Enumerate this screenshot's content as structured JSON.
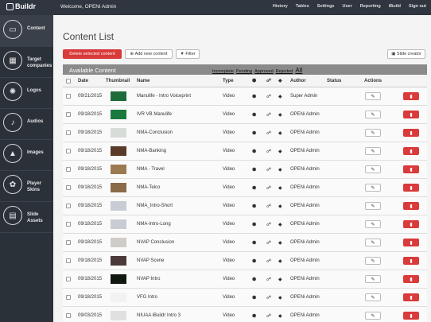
{
  "header": {
    "logo": "Buildr",
    "welcome": "Welcome, OPENi Admin",
    "nav": [
      "History",
      "Tables",
      "Settings",
      "User",
      "Reporting",
      "iBuild",
      "Sign out"
    ]
  },
  "sidebar": {
    "items": [
      {
        "label": "Content",
        "icon": "content-icon",
        "glyph": "▭"
      },
      {
        "label": "Target companies",
        "icon": "companies-icon",
        "glyph": "▦"
      },
      {
        "label": "Logos",
        "icon": "flame-icon",
        "glyph": "✺"
      },
      {
        "label": "Audios",
        "icon": "music-icon",
        "glyph": "♪"
      },
      {
        "label": "Images",
        "icon": "image-icon",
        "glyph": "▲"
      },
      {
        "label": "Player Skins",
        "icon": "palette-icon",
        "glyph": "✿"
      },
      {
        "label": "Slide Assets",
        "icon": "slides-icon",
        "glyph": "▤"
      }
    ]
  },
  "page": {
    "title": "Content List",
    "delete_label": "Delete selected content",
    "add_label": "Add new content",
    "filter_label": "Filter",
    "slide_creator_label": "Slide creator",
    "available": "Available Content",
    "filters": [
      "Incomplete",
      "Pending",
      "Approved",
      "Rejected",
      "All"
    ]
  },
  "table": {
    "headers": {
      "date": "Date",
      "thumb": "Thumbnail",
      "name": "Name",
      "type": "Type",
      "author": "Author",
      "status": "Status",
      "actions": "Actions"
    },
    "rows": [
      {
        "date": "09/21/2015",
        "name": "Manulife - Intro Voiceprint",
        "type": "Video",
        "author": "Super Admin",
        "thumb": "#1e6b3a"
      },
      {
        "date": "09/18/2015",
        "name": "IVR VB Manulife",
        "type": "Video",
        "author": "OPENi Admin",
        "thumb": "#1a7a3e"
      },
      {
        "date": "09/18/2015",
        "name": "NMA-Conclusion",
        "type": "Video",
        "author": "OPENi Admin",
        "thumb": "#d8dcd8"
      },
      {
        "date": "09/18/2015",
        "name": "NMA-Banking",
        "type": "Video",
        "author": "OPENi Admin",
        "thumb": "#5a3a28"
      },
      {
        "date": "09/18/2015",
        "name": "NMA - Travel",
        "type": "Video",
        "author": "OPENi Admin",
        "thumb": "#9a7a50"
      },
      {
        "date": "09/18/2015",
        "name": "NMA-Telco",
        "type": "Video",
        "author": "OPENi Admin",
        "thumb": "#8a6a48"
      },
      {
        "date": "09/18/2015",
        "name": "NMA_Intro-Short",
        "type": "Video",
        "author": "OPENi Admin",
        "thumb": "#c8ccd4"
      },
      {
        "date": "09/18/2015",
        "name": "NMA-Intro-Long",
        "type": "Video",
        "author": "OPENi Admin",
        "thumb": "#c8ccd4"
      },
      {
        "date": "09/18/2015",
        "name": "NVAP Conclusion",
        "type": "Video",
        "author": "OPENi Admin",
        "thumb": "#d0ccc8"
      },
      {
        "date": "09/18/2015",
        "name": "NVAP Scene",
        "type": "Video",
        "author": "OPENi Admin",
        "thumb": "#4a3a38"
      },
      {
        "date": "09/18/2015",
        "name": "NVAP Intro",
        "type": "Video",
        "author": "OPENi Admin",
        "thumb": "#101810"
      },
      {
        "date": "09/18/2015",
        "name": "VFG Intro",
        "type": "Video",
        "author": "OPENi Admin",
        "thumb": "#f2f2f2"
      },
      {
        "date": "09/03/2015",
        "name": "NIUAA iBuildr Intro 3",
        "type": "Video",
        "author": "OPENi Admin",
        "thumb": "#e0e0e0"
      }
    ]
  }
}
